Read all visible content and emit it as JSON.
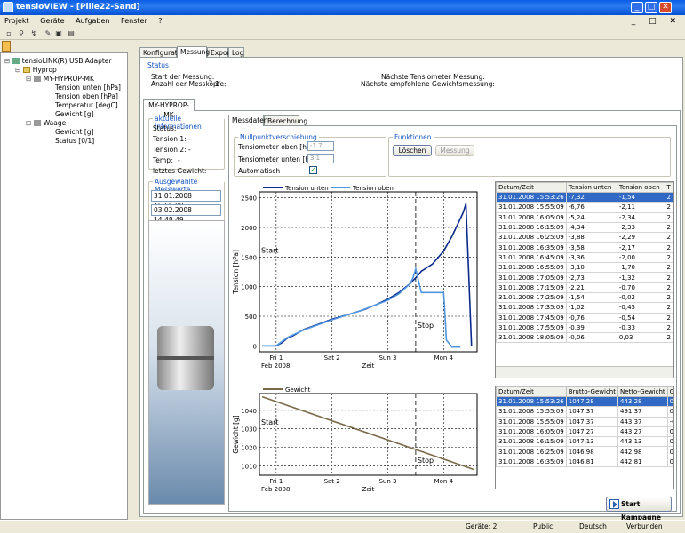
{
  "window": {
    "title": "tensioVIEW - [Pille22-Sand]"
  },
  "menu": [
    "Projekt",
    "Geräte",
    "Aufgaben",
    "Fenster",
    "?"
  ],
  "tree": {
    "root": "tensioLINK(R) USB Adapter",
    "hyprop": "Hyprop",
    "device": "MY-HYPROP-MK",
    "channels": [
      "Tension unten [hPa]",
      "Tension oben [hPa]",
      "Temperatur [degC]",
      "Gewicht [g]"
    ],
    "waage": "Waage",
    "waage_channels": [
      "Gewicht [g]",
      "Status [0/1]"
    ]
  },
  "tabs": [
    "Konfiguration",
    "Messung",
    "Export",
    "Log"
  ],
  "status": {
    "title": "Status",
    "start_label": "Start der Messung:",
    "count_label": "Anzahl der Messköpfe:",
    "count_value": "1",
    "next_tensio": "Nächste Tensiometer Messung:",
    "next_weight": "Nächste empfohlene Gewichtsmessung:"
  },
  "device_tab": "MY-HYPROP-MK",
  "info": {
    "title": "aktuelle Informationen",
    "rows": [
      {
        "label": "Status:",
        "value": "-"
      },
      {
        "label": "Tension 1:",
        "value": "-"
      },
      {
        "label": "Tension 2:",
        "value": "-"
      },
      {
        "label": "Temp:",
        "value": "-"
      },
      {
        "label": "letztes Gewicht:",
        "value": "-"
      }
    ]
  },
  "selection": {
    "title": "Ausgewählte Messwerte",
    "from": "31.01.2008 15:55:09",
    "to": "03.02.2008 14:48:49"
  },
  "subtabs": [
    "Messdaten",
    "Berechnung"
  ],
  "nullpunkt": {
    "title": "Nullpunktverschiebung",
    "oben_label": "Tensiometer oben [hPa]:",
    "oben_value": "-1.7",
    "unten_label": "Tensiometer unten [hPa]:",
    "unten_value": "3.1",
    "auto_label": "Automatisch",
    "auto_checked": true
  },
  "funktionen": {
    "title": "Funktionen",
    "loeschen": "Löschen",
    "messung": "Messung"
  },
  "chart_data": [
    {
      "type": "line",
      "title": "",
      "ylabel": "Tension [hPa]",
      "xlabel": "Zeit",
      "ylim": [
        -100,
        2600
      ],
      "yticks": [
        0,
        500,
        1000,
        1500,
        2000,
        2500
      ],
      "xticks": [
        "Fri 1",
        "Sat 2",
        "Sun 3",
        "Mon 4"
      ],
      "x_sub": "Feb 2008",
      "annotations": [
        "Start",
        "Stop"
      ],
      "series": [
        {
          "name": "Tension unten",
          "color": "#0a2a8c",
          "x": [
            -0.25,
            0,
            0.1,
            0.2,
            0.3,
            0.5,
            0.8,
            1.0,
            1.3,
            1.6,
            1.8,
            2.0,
            2.2,
            2.4,
            2.5,
            2.55,
            2.6,
            2.8,
            3.0,
            3.15,
            3.3,
            3.35,
            3.4,
            3.45,
            3.5
          ],
          "y": [
            0,
            0,
            50,
            130,
            170,
            280,
            380,
            450,
            530,
            620,
            700,
            790,
            900,
            1050,
            1150,
            1200,
            1260,
            1380,
            1600,
            1850,
            2150,
            2250,
            2400,
            1200,
            0
          ]
        },
        {
          "name": "Tension oben",
          "color": "#4f95e0",
          "x": [
            -0.25,
            0,
            0.2,
            0.5,
            1.0,
            1.5,
            2.0,
            2.2,
            2.4,
            2.45,
            2.5,
            2.55,
            2.6,
            2.9,
            3.0,
            3.02,
            3.05,
            3.15,
            3.2,
            3.3
          ],
          "y": [
            0,
            0,
            140,
            270,
            440,
            590,
            770,
            880,
            1050,
            1150,
            1300,
            1100,
            900,
            900,
            900,
            600,
            100,
            -20,
            -20,
            -20
          ]
        }
      ]
    },
    {
      "type": "line",
      "title": "",
      "ylabel": "Gewicht [g]",
      "xlabel": "Zeit",
      "ylim": [
        1005,
        1049
      ],
      "yticks": [
        1010,
        1020,
        1030,
        1040
      ],
      "xticks": [
        "Fri 1",
        "Sat 2",
        "Sun 3",
        "Mon 4"
      ],
      "x_sub": "Feb 2008",
      "annotations": [
        "Start",
        "Stop"
      ],
      "series": [
        {
          "name": "Gewicht",
          "color": "#7a6a4a",
          "x": [
            -0.25,
            3.55
          ],
          "y": [
            1047.3,
            1008
          ]
        }
      ]
    }
  ],
  "table1": {
    "headers": [
      "Datum/Zeit",
      "Tension unten",
      "Tension oben",
      "T"
    ],
    "rows": [
      [
        "31.01.2008 15:53:26",
        "-7,32",
        "-1,54",
        "2"
      ],
      [
        "31.01.2008 15:55:09",
        "-6,76",
        "-2,11",
        "2"
      ],
      [
        "31.01.2008 16:05:09",
        "-5,24",
        "-2,34",
        "2"
      ],
      [
        "31.01.2008 16:15:09",
        "-4,34",
        "-2,33",
        "2"
      ],
      [
        "31.01.2008 16:25:09",
        "-3,88",
        "-2,29",
        "2"
      ],
      [
        "31.01.2008 16:35:09",
        "-3,58",
        "-2,17",
        "2"
      ],
      [
        "31.01.2008 16:45:09",
        "-3,36",
        "-2,00",
        "2"
      ],
      [
        "31.01.2008 16:55:09",
        "-3,10",
        "-1,70",
        "2"
      ],
      [
        "31.01.2008 17:05:09",
        "-2,73",
        "-1,32",
        "2"
      ],
      [
        "31.01.2008 17:15:09",
        "-2,21",
        "-0,70",
        "2"
      ],
      [
        "31.01.2008 17:25:09",
        "-1,54",
        "-0,02",
        "2"
      ],
      [
        "31.01.2008 17:35:09",
        "-1,02",
        "-0,45",
        "2"
      ],
      [
        "31.01.2008 17:45:09",
        "-0,76",
        "-0,54",
        "2"
      ],
      [
        "31.01.2008 17:55:09",
        "-0,39",
        "-0,33",
        "2"
      ],
      [
        "31.01.2008 18:05:09",
        "-0,06",
        "0,03",
        "2"
      ]
    ]
  },
  "table2": {
    "headers": [
      "Datum/Zeit",
      "Brutto-Gewicht",
      "Netto-Gewicht",
      "Gewicht"
    ],
    "rows": [
      [
        "31.01.2008 15:53:26",
        "1047,28",
        "443,28",
        "0,00"
      ],
      [
        "31.01.2008 15:55:09",
        "1047,37",
        "491,37",
        "0,00"
      ],
      [
        "31.01.2008 15:55:09",
        "1047,37",
        "443,37",
        "-0,09"
      ],
      [
        "31.01.2008 16:05:09",
        "1047,27",
        "443,27",
        "0,01"
      ],
      [
        "31.01.2008 16:15:09",
        "1047,13",
        "443,13",
        "0,15"
      ],
      [
        "31.01.2008 16:25:09",
        "1046,98",
        "442,98",
        "0,30"
      ],
      [
        "31.01.2008 16:35:09",
        "1046,81",
        "442,81",
        "0,47"
      ]
    ]
  },
  "start_button": "Start Kampagne",
  "statusbar": {
    "devices": "Geräte: 2",
    "profile": "Public",
    "language": "Deutsch",
    "state": "Verbunden"
  }
}
